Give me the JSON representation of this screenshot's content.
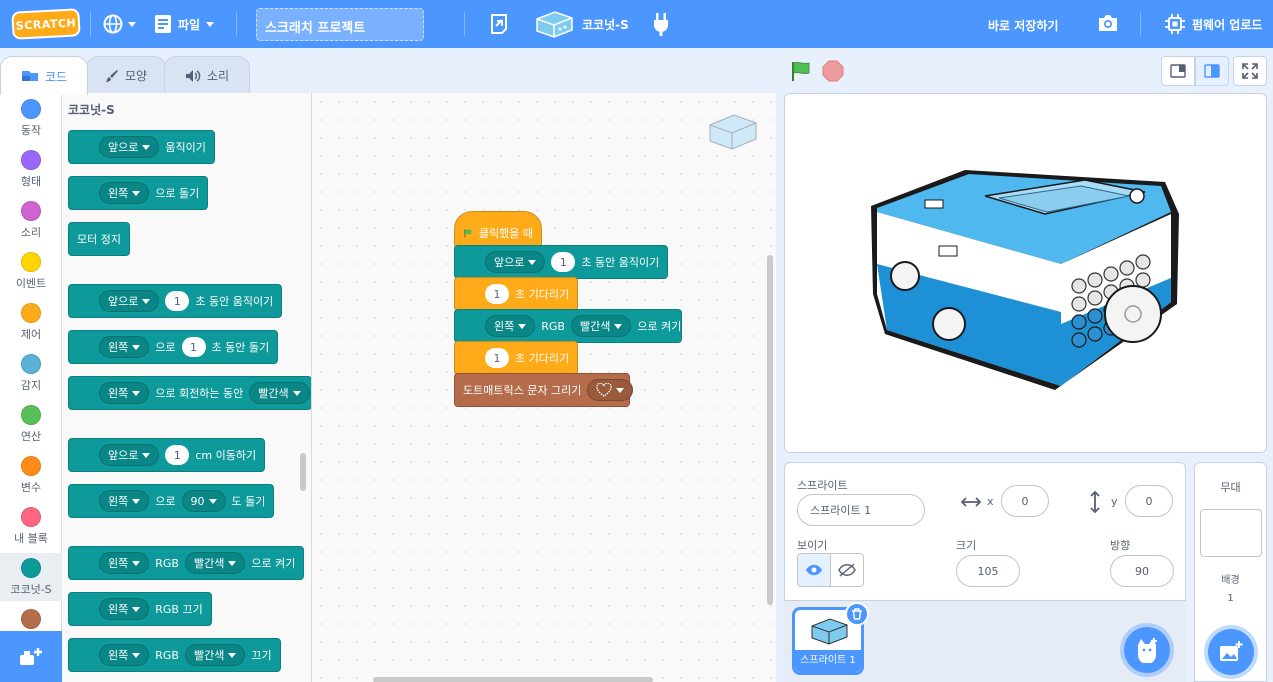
{
  "menu": {
    "logo": "SCRATCH",
    "file": "파일",
    "project_title": "스크래치 프로젝트",
    "device_name": "코코넛-S",
    "save_now": "바로 저장하기",
    "firmware": "펌웨어 업로드"
  },
  "tabs": {
    "code": "코드",
    "costume": "모양",
    "sound": "소리"
  },
  "categories": [
    {
      "label": "동작",
      "color": "#4c97ff"
    },
    {
      "label": "형태",
      "color": "#9966ff"
    },
    {
      "label": "소리",
      "color": "#cf63cf"
    },
    {
      "label": "이벤트",
      "color": "#ffd500"
    },
    {
      "label": "제어",
      "color": "#ffab19"
    },
    {
      "label": "감지",
      "color": "#5cb1d6"
    },
    {
      "label": "연산",
      "color": "#59c059"
    },
    {
      "label": "변수",
      "color": "#ff8c1a"
    },
    {
      "label": "내 블록",
      "color": "#ff6680"
    },
    {
      "label": "코코넛-S",
      "color": "#0e9a9a"
    }
  ],
  "palette": {
    "title": "코코넛-S",
    "b1": {
      "dd": "앞으로",
      "text": "움직이기"
    },
    "b2": {
      "dd": "왼쪽",
      "text": "으로 돌기"
    },
    "b3": {
      "text": "모터 정지"
    },
    "b4": {
      "dd": "앞으로",
      "num": "1",
      "text": "초 동안 움직이기"
    },
    "b5": {
      "dd": "왼쪽",
      "pre": "으로",
      "num": "1",
      "text": "초 동안 돌기"
    },
    "b6": {
      "dd": "왼쪽",
      "text": "으로 회전하는 동안",
      "dd2": "빨간색"
    },
    "b7": {
      "dd": "앞으로",
      "num": "1",
      "text": "cm 이동하기"
    },
    "b8": {
      "dd": "왼쪽",
      "pre": "으로",
      "num": "90",
      "text": "도 돌기"
    },
    "b9": {
      "dd": "왼쪽",
      "pre": "RGB",
      "dd2": "빨간색",
      "text": "으로 켜기"
    },
    "b10": {
      "dd": "왼쪽",
      "text": "RGB 끄기"
    },
    "b11": {
      "dd": "왼쪽",
      "pre": "RGB",
      "dd2": "빨간색",
      "text": "끄기"
    }
  },
  "script": {
    "hat": "클릭했을 때",
    "s1": {
      "dd": "앞으로",
      "num": "1",
      "text": "초 동안 움직이기"
    },
    "s2": {
      "num": "1",
      "text": "초 기다리기"
    },
    "s3": {
      "dd": "왼쪽",
      "pre": "RGB",
      "dd2": "빨간색",
      "text": "으로 켜기"
    },
    "s4": {
      "num": "1",
      "text": "초 기다리기"
    },
    "s5": {
      "text": "도트매트릭스 문자 그리기"
    }
  },
  "sprite": {
    "section": "스프라이트",
    "name": "스프라이트 1",
    "x_label": "x",
    "x": "0",
    "y_label": "y",
    "y": "0",
    "show_label": "보이기",
    "size_label": "크기",
    "size": "105",
    "direction_label": "방향",
    "direction": "90",
    "thumb_label": "스프라이트 1"
  },
  "stage_pane": {
    "title": "무대",
    "backdrops_label": "배경",
    "backdrops_count": "1"
  }
}
